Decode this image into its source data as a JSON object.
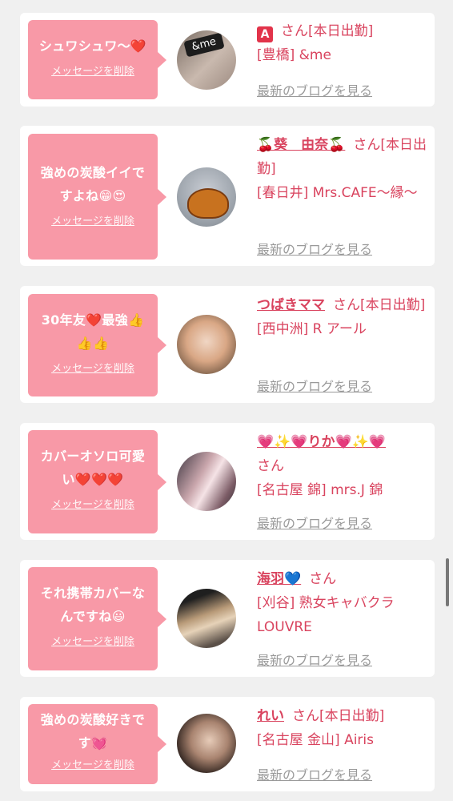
{
  "delete_label": "メッセージを削除",
  "blog_label": "最新のブログを見る",
  "san": "さん",
  "entries": [
    {
      "message": "シュワシュワ〜❤️",
      "name_prefix": "🅰️",
      "name": "",
      "status": "[本日出勤]",
      "shop": "[豊橋] &me",
      "avatar_text": "&me"
    },
    {
      "message": "強めの炭酸イイですよね😁😍",
      "name": "🍒葵　由奈🍒",
      "status": "[本日出勤]",
      "shop": "[春日井] Mrs.CAFE〜縁〜"
    },
    {
      "message": "30年友❤️最強👍👍👍",
      "name": "つばきママ",
      "status": "[本日出勤]",
      "shop": "[西中洲] R アール"
    },
    {
      "message": "カバーオソロ可愛い❤️❤️❤️",
      "name": "💗✨💗りか💗✨💗",
      "status": "",
      "shop": "[名古屋 錦] mrs.J 錦"
    },
    {
      "message": "それ携帯カバーなんですね😃",
      "name": "海羽💙",
      "status": "",
      "shop": "[刈谷] 熟女キャバクラ LOUVRE"
    },
    {
      "message": "強めの炭酸好きです💓",
      "name": "れい",
      "status": "[本日出勤]",
      "shop": "[名古屋 金山] Airis"
    }
  ],
  "colors": {
    "bubble": "#f899a7",
    "accent": "#d9435e",
    "link_gray": "#9a9a9a",
    "background": "#f0f0f0"
  }
}
